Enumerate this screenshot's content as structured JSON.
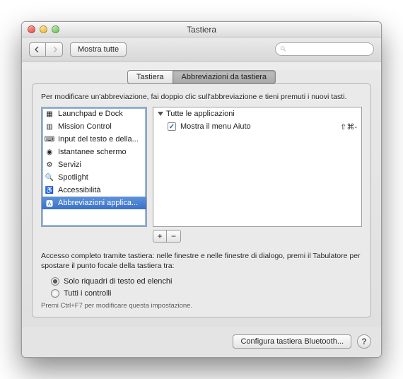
{
  "window": {
    "title": "Tastiera"
  },
  "toolbar": {
    "show_all": "Mostra tutte",
    "search_placeholder": ""
  },
  "tabs": [
    {
      "label": "Tastiera"
    },
    {
      "label": "Abbreviazioni da tastiera"
    }
  ],
  "panel": {
    "instruction": "Per modificare un'abbreviazione, fai doppio clic sull'abbreviazione e tieni premuti i nuovi tasti."
  },
  "categories": [
    {
      "icon": "grid-icon",
      "label": "Launchpad e Dock"
    },
    {
      "icon": "mission-icon",
      "label": "Mission Control"
    },
    {
      "icon": "keyboard-icon",
      "label": "Input del testo e della..."
    },
    {
      "icon": "camera-icon",
      "label": "Istantanee schermo"
    },
    {
      "icon": "gear-icon",
      "label": "Servizi"
    },
    {
      "icon": "spotlight-icon",
      "label": "Spotlight"
    },
    {
      "icon": "accessibility-icon",
      "label": "Accessibilità"
    },
    {
      "icon": "app-icon",
      "label": "Abbreviazioni applica..."
    }
  ],
  "shortcuts": {
    "group": "Tutte le applicazioni",
    "items": [
      {
        "checked": true,
        "label": "Mostra il menu Aiuto",
        "keys": "⇧⌘-"
      }
    ]
  },
  "buttons": {
    "add": "+",
    "remove": "−"
  },
  "access": {
    "text": "Accesso completo tramite tastiera: nelle finestre e nelle finestre di dialogo, premi il Tabulatore per spostare il punto focale della tastiera tra:",
    "opt1": "Solo riquadri di testo ed elenchi",
    "opt2": "Tutti i controlli",
    "hint": "Premi Ctrl+F7 per modificare questa impostazione."
  },
  "footer": {
    "bluetooth": "Configura tastiera Bluetooth..."
  }
}
